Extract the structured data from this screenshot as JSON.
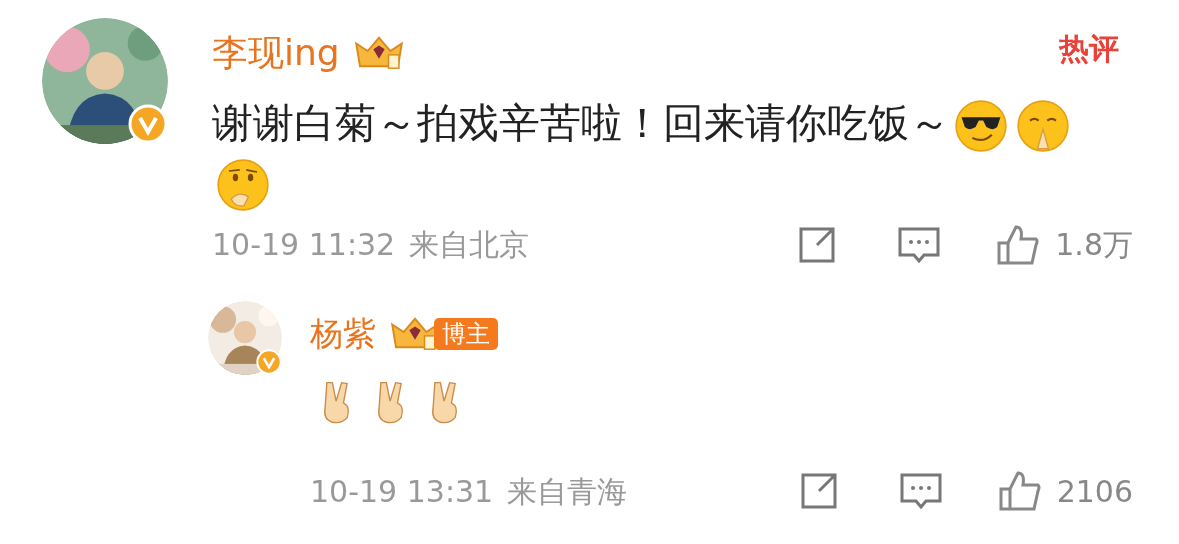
{
  "comments": [
    {
      "kind": "comment",
      "author": "李现ing",
      "hot_label": "热评",
      "text": "谢谢白菊～拍戏辛苦啦！回来请你吃饭～",
      "emojis": [
        {
          "kind": "cool"
        },
        {
          "kind": "thanks"
        },
        {
          "kind": "thinking"
        }
      ],
      "time": "10-19 11:32",
      "location": "来自北京",
      "likes": "1.8万"
    },
    {
      "kind": "reply",
      "author": "杨紫",
      "badge_label": "博主",
      "emojis": [
        {
          "kind": "victory"
        },
        {
          "kind": "victory"
        },
        {
          "kind": "victory"
        }
      ],
      "time": "10-19 13:31",
      "location": "来自青海",
      "likes": "2106"
    }
  ]
}
